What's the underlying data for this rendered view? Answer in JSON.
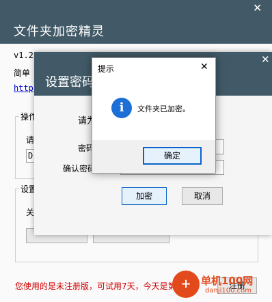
{
  "main_window": {
    "title": "文件夹加密精灵",
    "close_glyph": "✕",
    "version_text": "v1.2.",
    "intro_text": "简单",
    "link_text": "http",
    "group1_label": "操作",
    "group1_hint": "请",
    "path_field_value": "D",
    "group2_label": "设置",
    "group2_text": "关",
    "notice_text": "您使用的是未注册版，可试用7天，今天是第1天。",
    "register_button": "注册"
  },
  "password_dialog": {
    "title": "设置密码",
    "close_glyph": "✕",
    "prompt_text": "请为",
    "password_label": "密码",
    "confirm_label": "确认密码",
    "encrypt_button": "加密",
    "cancel_button": "取消"
  },
  "alert_dialog": {
    "title": "提示",
    "close_glyph": "✕",
    "icon_glyph": "i",
    "message": "文件夹已加密。",
    "ok_button": "确定"
  },
  "watermark": {
    "text": "单机100网",
    "url": "danji100.com"
  },
  "colors": {
    "titlebar": "#425a68",
    "info_icon": "#1c6fd6",
    "notice": "#d00000",
    "ok_border": "#0a64c8"
  }
}
